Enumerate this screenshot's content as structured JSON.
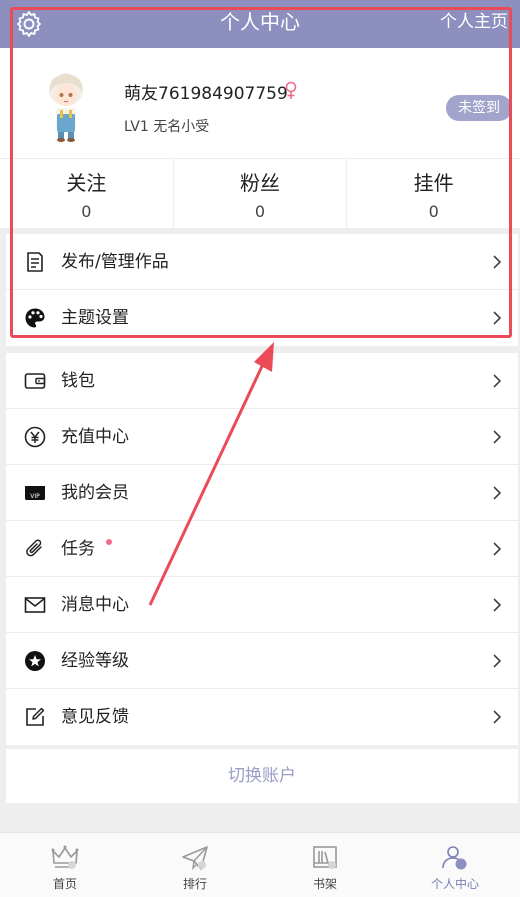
{
  "header": {
    "title": "个人中心",
    "homepage_link": "个人主页",
    "settings_icon": "gear-icon",
    "background": "#8d8fbe"
  },
  "profile": {
    "username": "萌友761984907759",
    "gender_icon": "female-icon",
    "level_text": "LV1 无名小受",
    "signin_badge": "未签到"
  },
  "stats": [
    {
      "label": "关注",
      "value": "0"
    },
    {
      "label": "粉丝",
      "value": "0"
    },
    {
      "label": "挂件",
      "value": "0"
    }
  ],
  "menu_group_1": [
    {
      "label": "发布/管理作品",
      "icon": "document-icon"
    },
    {
      "label": "主题设置",
      "icon": "palette-icon"
    }
  ],
  "menu_group_2": [
    {
      "label": "钱包",
      "icon": "wallet-icon"
    },
    {
      "label": "充值中心",
      "icon": "yuan-icon"
    },
    {
      "label": "我的会员",
      "icon": "vip-icon"
    },
    {
      "label": "任务",
      "icon": "paperclip-icon",
      "has_dot": true
    },
    {
      "label": "消息中心",
      "icon": "mail-icon"
    },
    {
      "label": "经验等级",
      "icon": "star-badge-icon"
    },
    {
      "label": "意见反馈",
      "icon": "edit-icon"
    }
  ],
  "switch_account": "切换账户",
  "bottom_nav": [
    {
      "label": "首页",
      "icon": "crown-icon",
      "active": false
    },
    {
      "label": "排行",
      "icon": "paper-plane-icon",
      "active": false
    },
    {
      "label": "书架",
      "icon": "bookshelf-icon",
      "active": false
    },
    {
      "label": "个人中心",
      "icon": "person-icon",
      "active": true
    }
  ],
  "colors": {
    "accent": "#8d8fbe",
    "annotation": "#ea4b57",
    "dot": "#ef6b8c"
  }
}
